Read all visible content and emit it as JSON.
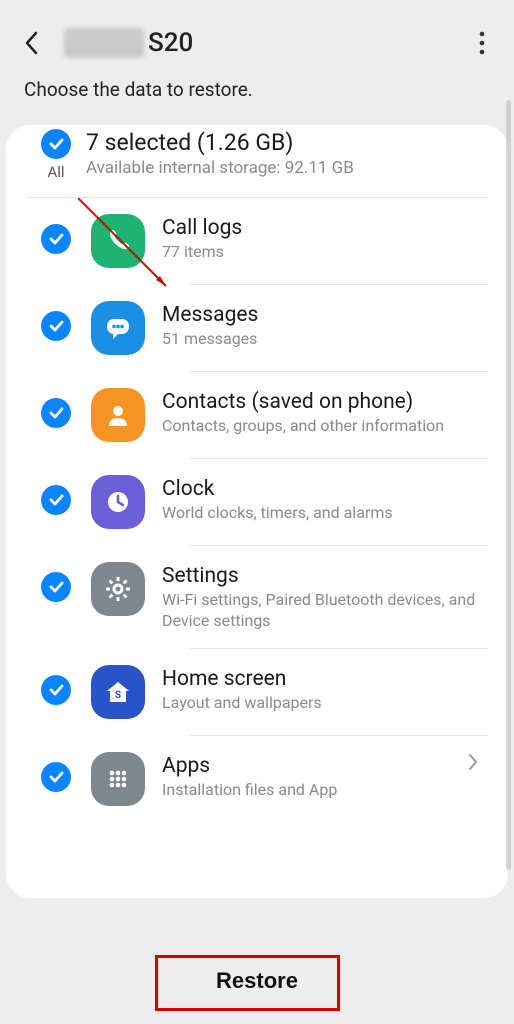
{
  "header": {
    "device_suffix": "S20"
  },
  "instruction": "Choose the data to restore.",
  "summary": {
    "all_label": "All",
    "title": "7 selected (1.26 GB)",
    "subtitle": "Available internal storage: 92.11 GB"
  },
  "items": [
    {
      "title": "Call logs",
      "subtitle": "77 items",
      "icon": "phone",
      "color": "#1fb371",
      "chevron": false
    },
    {
      "title": "Messages",
      "subtitle": "51 messages",
      "icon": "chat",
      "color": "#1a8fe3",
      "chevron": false
    },
    {
      "title": "Contacts (saved on phone)",
      "subtitle": "Contacts, groups, and other information",
      "icon": "person",
      "color": "#f59423",
      "chevron": false
    },
    {
      "title": "Clock",
      "subtitle": "World clocks, timers, and alarms",
      "icon": "clock",
      "color": "#6b5fd7",
      "chevron": false
    },
    {
      "title": "Settings",
      "subtitle": "Wi-Fi settings, Paired Bluetooth devices, and Device settings",
      "icon": "gear",
      "color": "#7e8790",
      "chevron": false
    },
    {
      "title": "Home screen",
      "subtitle": "Layout and wallpapers",
      "icon": "home",
      "color": "#2954c8",
      "chevron": false
    },
    {
      "title": "Apps",
      "subtitle": "Installation files and App",
      "icon": "grid",
      "color": "#7e8790",
      "chevron": true
    }
  ],
  "restore_label": "Restore"
}
